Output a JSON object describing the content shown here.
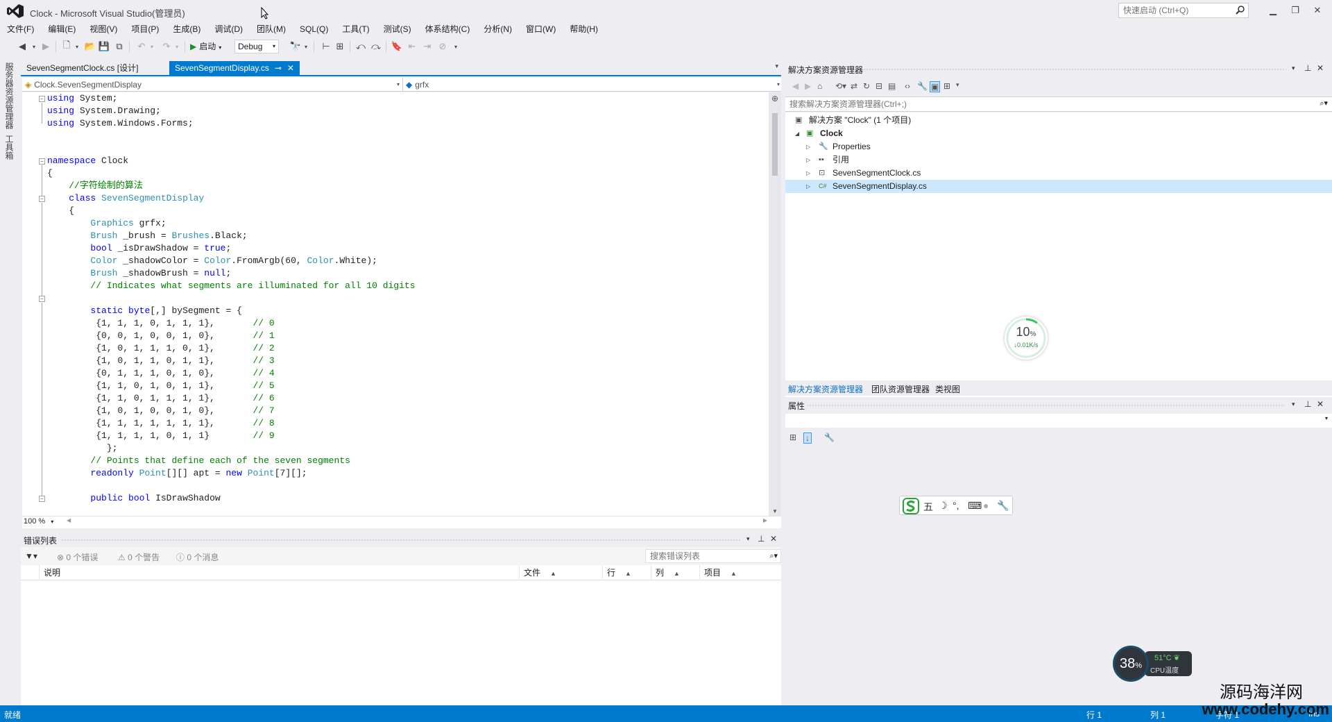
{
  "window": {
    "title": "Clock - Microsoft Visual Studio(管理员)",
    "quick_launch_placeholder": "快速启动 (Ctrl+Q)"
  },
  "menu": [
    "文件(F)",
    "编辑(E)",
    "视图(V)",
    "项目(P)",
    "生成(B)",
    "调试(D)",
    "团队(M)",
    "SQL(Q)",
    "工具(T)",
    "测试(S)",
    "体系结构(C)",
    "分析(N)",
    "窗口(W)",
    "帮助(H)"
  ],
  "toolbar": {
    "start_label": "启动",
    "config_value": "Debug"
  },
  "left_tabs": [
    "服务器资源管理器",
    "工具箱"
  ],
  "editor": {
    "tabs": [
      {
        "label": "SevenSegmentClock.cs [设计]",
        "active": false
      },
      {
        "label": "SevenSegmentDisplay.cs",
        "active": true
      }
    ],
    "nav_type": "Clock.SevenSegmentDisplay",
    "nav_member": "grfx",
    "zoom": "100 %",
    "code_lines": [
      "using System;",
      "using System.Drawing;",
      "using System.Windows.Forms;",
      "",
      "",
      "namespace Clock",
      "{",
      "    //字符绘制的算法",
      "    class SevenSegmentDisplay",
      "    {",
      "        Graphics grfx;",
      "        Brush _brush = Brushes.Black;",
      "        bool _isDrawShadow = true;",
      "        Color _shadowColor = Color.FromArgb(60, Color.White);",
      "        Brush _shadowBrush = null;",
      "        // Indicates what segments are illuminated for all 10 digits",
      "",
      "        static byte[,] bySegment = {",
      "         {1, 1, 1, 0, 1, 1, 1},       // 0",
      "         {0, 0, 1, 0, 0, 1, 0},       // 1",
      "         {1, 0, 1, 1, 1, 0, 1},       // 2",
      "         {1, 0, 1, 1, 0, 1, 1},       // 3",
      "         {0, 1, 1, 1, 0, 1, 0},       // 4",
      "         {1, 1, 0, 1, 0, 1, 1},       // 5",
      "         {1, 1, 0, 1, 1, 1, 1},       // 6",
      "         {1, 0, 1, 0, 0, 1, 0},       // 7",
      "         {1, 1, 1, 1, 1, 1, 1},       // 8",
      "         {1, 1, 1, 1, 0, 1, 1}        // 9",
      "           };",
      "        // Points that define each of the seven segments",
      "        readonly Point[][] apt = new Point[7][];",
      "",
      "        public bool IsDrawShadow",
      "        {"
    ]
  },
  "error_list": {
    "title": "错误列表",
    "errors": "0 个错误",
    "warnings": "0 个警告",
    "messages": "0 个消息",
    "search_placeholder": "搜索错误列表",
    "columns": [
      "说明",
      "文件",
      "行",
      "列",
      "项目"
    ]
  },
  "solution_explorer": {
    "title": "解决方案资源管理器",
    "search_placeholder": "搜索解决方案资源管理器(Ctrl+;)",
    "tree": [
      {
        "label": "解决方案 \"Clock\" (1 个项目)",
        "icon": "solution-icon",
        "level": 0
      },
      {
        "label": "Clock",
        "icon": "csharp-project-icon",
        "level": 1,
        "bold": true
      },
      {
        "label": "Properties",
        "icon": "wrench-icon",
        "level": 2
      },
      {
        "label": "引用",
        "icon": "references-icon",
        "level": 2
      },
      {
        "label": "SevenSegmentClock.cs",
        "icon": "form-icon",
        "level": 2
      },
      {
        "label": "SevenSegmentDisplay.cs",
        "icon": "csharp-file-icon",
        "level": 2,
        "selected": true
      }
    ],
    "tabs": [
      "解决方案资源管理器",
      "团队资源管理器",
      "类视图"
    ]
  },
  "properties": {
    "title": "属性"
  },
  "network_widget": {
    "percent": "10",
    "unit": "%",
    "speed": "↓0.01K/s",
    "progress": 0.1
  },
  "ime_bar": {
    "mode_char": "五"
  },
  "cpu_widget": {
    "usage": "38",
    "unit": "%",
    "temperature": "51°C",
    "label": "CPU温度"
  },
  "statusbar": {
    "status": "就绪",
    "line": "行 1",
    "col": "列 1",
    "char": "字符 1",
    "mode": "Ins"
  },
  "watermark": {
    "cn": "源码海洋网",
    "en": "www.codehy.com"
  },
  "colors": {
    "accent": "#007acc",
    "keyword": "#0000ff",
    "type": "#2b91af",
    "comment": "#008000"
  }
}
